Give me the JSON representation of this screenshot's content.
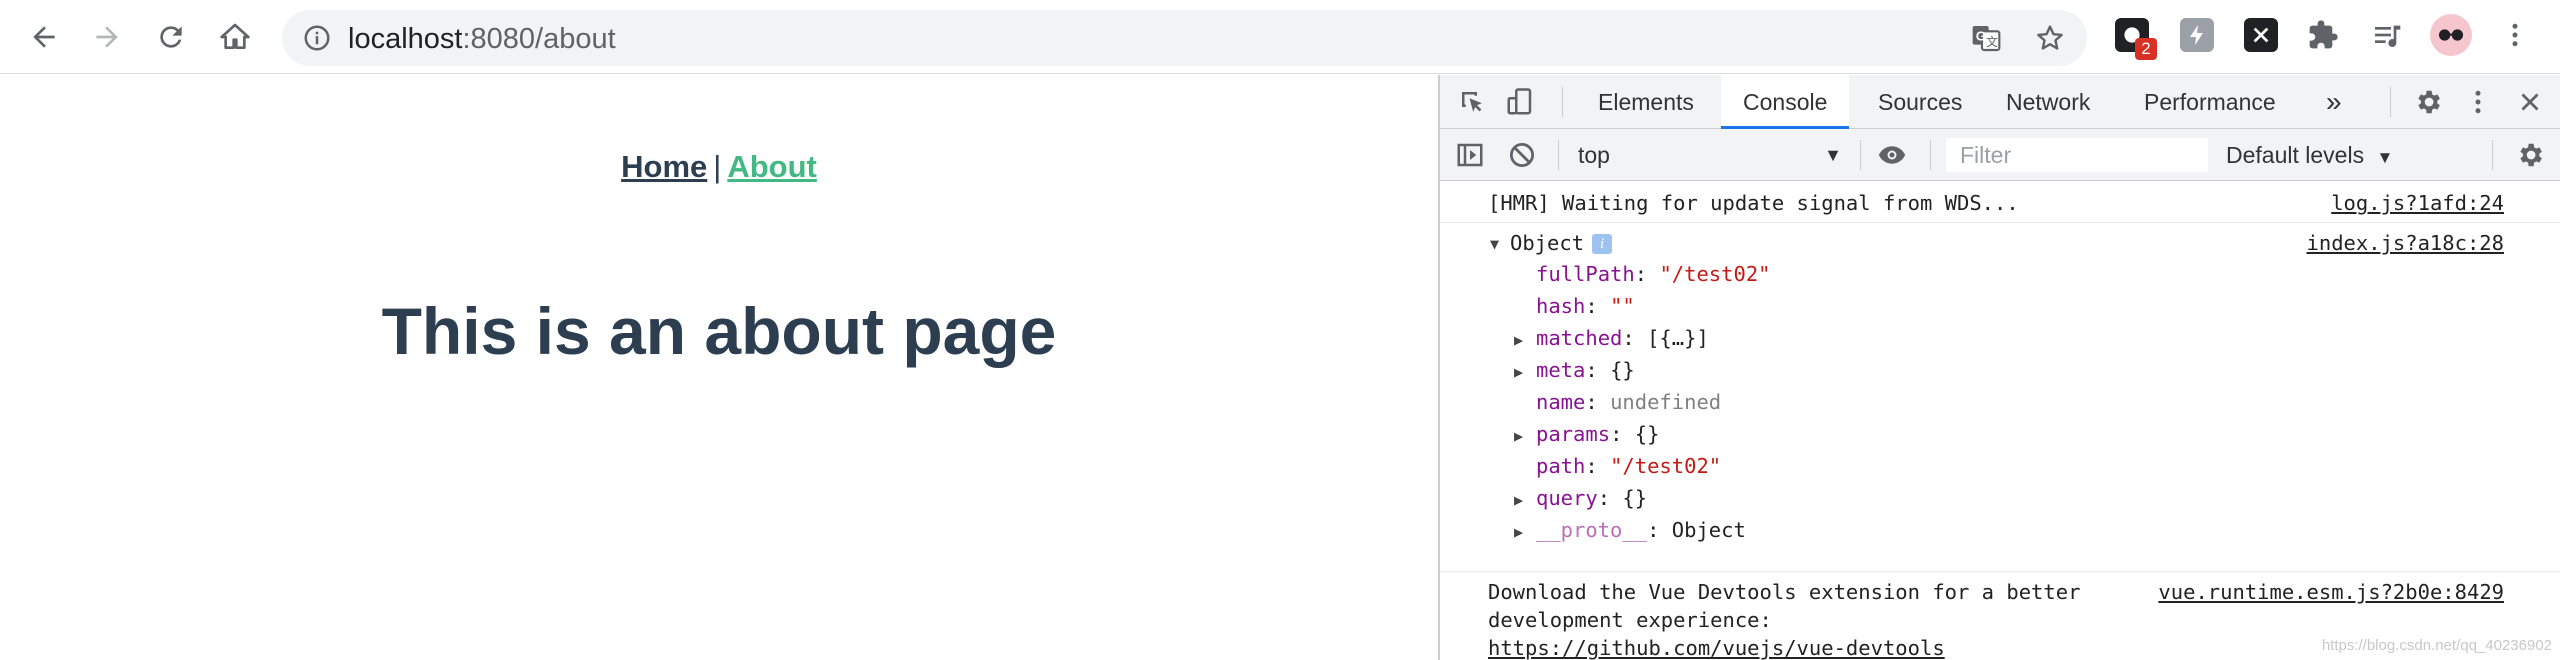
{
  "browser": {
    "url_host": "localhost",
    "url_rest": ":8080/about",
    "extension_badge": "2"
  },
  "page": {
    "nav": {
      "home": "Home",
      "separator": "|",
      "about": "About"
    },
    "heading": "This is an about page"
  },
  "devtools": {
    "tabs": [
      "Elements",
      "Console",
      "Sources",
      "Network",
      "Performance"
    ],
    "more_tabs": "»",
    "context": "top",
    "filter_placeholder": "Filter",
    "levels": "Default levels",
    "messages": {
      "hmr": {
        "text": "[HMR] Waiting for update signal from WDS...",
        "source": "log.js?1afd:24"
      },
      "object": {
        "label": "Object",
        "source": "index.js?a18c:28",
        "props": {
          "fullPath_key": "fullPath",
          "fullPath_val": "\"/test02\"",
          "hash_key": "hash",
          "hash_val": "\"\"",
          "matched_key": "matched",
          "matched_val": "[{…}]",
          "meta_key": "meta",
          "meta_val": "{}",
          "name_key": "name",
          "name_val": "undefined",
          "params_key": "params",
          "params_val": "{}",
          "path_key": "path",
          "path_val": "\"/test02\"",
          "query_key": "query",
          "query_val": "{}",
          "proto_key": "__proto__",
          "proto_val": "Object"
        }
      },
      "vue": {
        "line1": "Download the Vue Devtools extension for a better",
        "line2": "development experience:",
        "link": "https://github.com/vuejs/vue-devtools",
        "source": "vue.runtime.esm.js?2b0e:8429"
      }
    },
    "watermark": "https://blog.csdn.net/qq_40236902"
  },
  "colors": {
    "vue_green": "#42b983",
    "vue_dark": "#2c3e50",
    "devtools_blue": "#1a73e8"
  }
}
